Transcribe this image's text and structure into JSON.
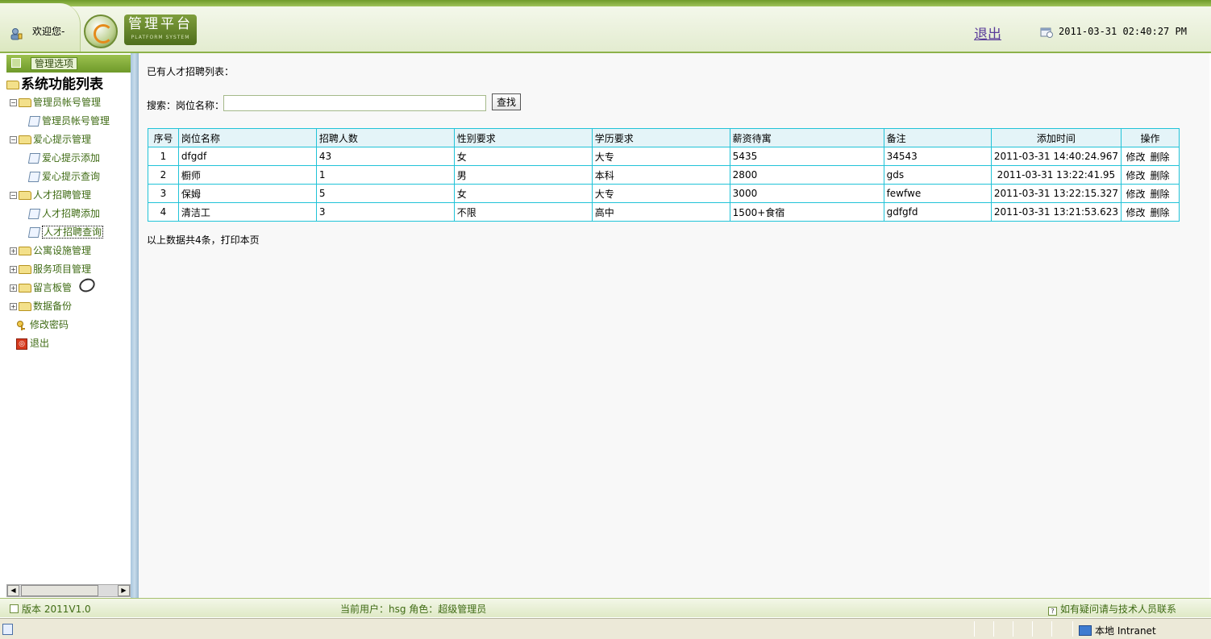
{
  "header": {
    "welcome": "欢迎您-",
    "logo_title": "管理平台",
    "logo_subtitle": "PLATFORM SYSTEM",
    "logout": "退出",
    "datetime": "2011-03-31 02:40:27 PM"
  },
  "sidebar": {
    "options_label": "管理选项",
    "root_label": "系统功能列表",
    "items": [
      {
        "label": "管理员帐号管理",
        "type": "folder",
        "expanded": true
      },
      {
        "label": "管理员帐号管理",
        "type": "page"
      },
      {
        "label": "爱心提示管理",
        "type": "folder",
        "expanded": true
      },
      {
        "label": "爱心提示添加",
        "type": "page"
      },
      {
        "label": "爱心提示查询",
        "type": "page"
      },
      {
        "label": "人才招聘管理",
        "type": "folder",
        "expanded": true
      },
      {
        "label": "人才招聘添加",
        "type": "page"
      },
      {
        "label": "人才招聘查询",
        "type": "page",
        "selected": true
      },
      {
        "label": "公寓设施管理",
        "type": "folder",
        "expanded": false
      },
      {
        "label": "服务项目管理",
        "type": "folder",
        "expanded": false
      },
      {
        "label": "留言板管",
        "type": "folder",
        "expanded": false
      },
      {
        "label": "数据备份",
        "type": "folder",
        "expanded": false
      },
      {
        "label": "修改密码",
        "type": "key"
      },
      {
        "label": "退出",
        "type": "exit"
      }
    ]
  },
  "main": {
    "list_title": "已有人才招聘列表：",
    "search_label": "搜索：岗位名称：",
    "search_value": "",
    "search_button": "查找",
    "table": {
      "headers": [
        "序号",
        "岗位名称",
        "招聘人数",
        "性别要求",
        "学历要求",
        "薪资待寓",
        "备注",
        "添加时间",
        "操作"
      ],
      "rows": [
        [
          "1",
          "dfgdf",
          "43",
          "女",
          "大专",
          "5435",
          "34543",
          "2011-03-31 14:40:24.967"
        ],
        [
          "2",
          "橱师",
          "1",
          "男",
          "本科",
          "2800",
          "gds",
          "2011-03-31 13:22:41.95"
        ],
        [
          "3",
          "保姆",
          "5",
          "女",
          "大专",
          "3000",
          "fewfwe",
          "2011-03-31 13:22:15.327"
        ],
        [
          "4",
          "清洁工",
          "3",
          "不限",
          "高中",
          "1500+食宿",
          "gdfgfd",
          "2011-03-31 13:21:53.623"
        ]
      ],
      "edit_label": "修改",
      "delete_label": "删除"
    },
    "summary": "以上数据共4条，打印本页"
  },
  "footer": {
    "version": "版本 2011V1.0",
    "current_user": "当前用户：hsg  角色：超级管理员",
    "help": "如有疑问请与技术人员联系"
  },
  "statusbar": {
    "zone": "本地 Intranet"
  },
  "colors": {
    "theme_green": "#6f9a2a",
    "table_border": "#21c3d8",
    "header_bg": "#e4f4f8"
  }
}
